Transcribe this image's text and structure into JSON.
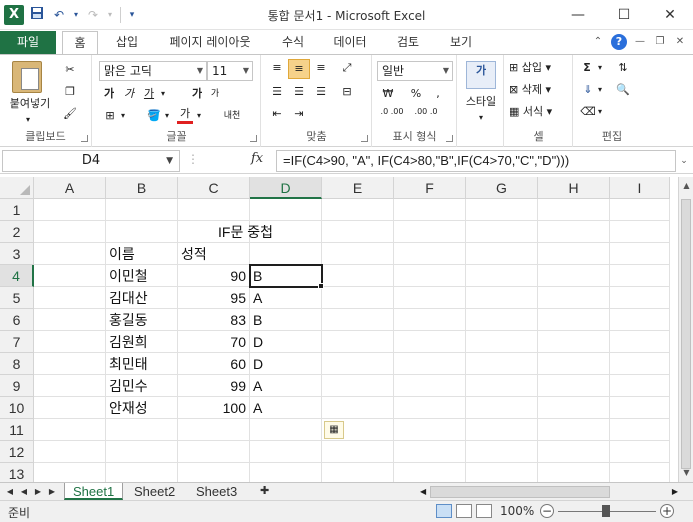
{
  "window": {
    "title": "통합 문서1  -  Microsoft Excel",
    "logo": "X"
  },
  "ribbon_tabs": [
    "파일",
    "홈",
    "삽입",
    "페이지 레이아웃",
    "수식",
    "데이터",
    "검토",
    "보기"
  ],
  "active_tab": "홈",
  "ribbon": {
    "clipboard": {
      "paste_label": "붙여넣기",
      "group_label": "클립보드"
    },
    "font": {
      "font_name": "맑은 고딕",
      "font_size": "11",
      "group_label": "글꼴",
      "bold": "가",
      "italic": "가",
      "underline": "가",
      "grow": "가",
      "shrink": "가",
      "font_color": "가",
      "phonetic": "내천"
    },
    "alignment": {
      "group_label": "맞춤"
    },
    "number": {
      "format": "일반",
      "percent": "%",
      "comma": ",",
      "dec_inc": ".0 .00",
      "dec_dec": ".00 .0",
      "group_label": "표시 형식"
    },
    "styles": {
      "label": "스타일"
    },
    "cells": {
      "insert": "삽입",
      "delete": "삭제",
      "format": "서식",
      "group_label": "셀"
    },
    "editing": {
      "sum": "Σ",
      "group_label": "편집"
    }
  },
  "formula_bar": {
    "name_box": "D4",
    "fx": "fx",
    "formula": "=IF(C4>90, \"A\", IF(C4>80,\"B\",IF(C4>70,\"C\",\"D\")))"
  },
  "grid": {
    "columns": [
      "A",
      "B",
      "C",
      "D",
      "E",
      "F",
      "G",
      "H",
      "I"
    ],
    "rows": [
      "1",
      "2",
      "3",
      "4",
      "5",
      "6",
      "7",
      "8",
      "9",
      "10",
      "11",
      "12",
      "13"
    ],
    "selected_column": "D",
    "selected_row": "4",
    "title_cell": "IF문 중첩",
    "header_name": "이름",
    "header_score": "성적",
    "records": [
      {
        "name": "이민철",
        "score": "90",
        "grade": "B"
      },
      {
        "name": "김대산",
        "score": "95",
        "grade": "A"
      },
      {
        "name": "홍길동",
        "score": "83",
        "grade": "B"
      },
      {
        "name": "김원희",
        "score": "70",
        "grade": "D"
      },
      {
        "name": "최민태",
        "score": "60",
        "grade": "D"
      },
      {
        "name": "김민수",
        "score": "99",
        "grade": "A"
      },
      {
        "name": "안재성",
        "score": "100",
        "grade": "A"
      }
    ]
  },
  "sheets": [
    "Sheet1",
    "Sheet2",
    "Sheet3"
  ],
  "active_sheet": "Sheet1",
  "status": {
    "ready": "준비",
    "zoom": "100%"
  },
  "colors": {
    "excel_green": "#1f7244",
    "selection_border": "#1e1e1e"
  }
}
